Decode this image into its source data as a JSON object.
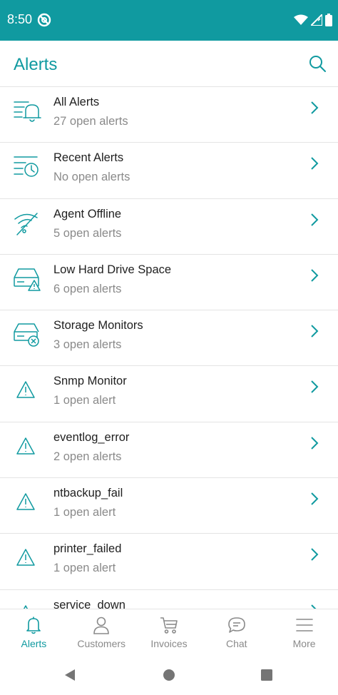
{
  "status_bar": {
    "time": "8:50",
    "icons": [
      "sync-disabled-icon",
      "wifi-icon",
      "signal-icon",
      "battery-icon"
    ],
    "background": "#109aa0"
  },
  "header": {
    "title": "Alerts",
    "search_icon": "search-icon"
  },
  "colors": {
    "accent": "#109aa0",
    "secondary_text": "#8a8a8a",
    "divider": "#e4e4e4"
  },
  "alerts": [
    {
      "name": "All Alerts",
      "count": "27 open alerts",
      "icon": "bell-list-icon"
    },
    {
      "name": "Recent Alerts",
      "count": "No open alerts",
      "icon": "clock-list-icon"
    },
    {
      "name": "Agent Offline",
      "count": "5 open alerts",
      "icon": "wifi-off-icon"
    },
    {
      "name": "Low Hard Drive Space",
      "count": "6 open alerts",
      "icon": "drive-warning-icon"
    },
    {
      "name": "Storage Monitors",
      "count": "3 open alerts",
      "icon": "drive-error-icon"
    },
    {
      "name": "Snmp Monitor",
      "count": "1 open alert",
      "icon": "warning-icon"
    },
    {
      "name": "eventlog_error",
      "count": "2 open alerts",
      "icon": "warning-icon"
    },
    {
      "name": "ntbackup_fail",
      "count": "1 open alert",
      "icon": "warning-icon"
    },
    {
      "name": "printer_failed",
      "count": "1 open alert",
      "icon": "warning-icon"
    },
    {
      "name": "service_down",
      "count": "",
      "icon": "warning-icon"
    }
  ],
  "bottom_nav": [
    {
      "label": "Alerts",
      "icon": "bell-icon",
      "active": true
    },
    {
      "label": "Customers",
      "icon": "person-icon",
      "active": false
    },
    {
      "label": "Invoices",
      "icon": "cart-icon",
      "active": false
    },
    {
      "label": "Chat",
      "icon": "chat-icon",
      "active": false
    },
    {
      "label": "More",
      "icon": "menu-icon",
      "active": false
    }
  ],
  "system_nav": [
    "back-icon",
    "home-icon",
    "recents-icon"
  ]
}
